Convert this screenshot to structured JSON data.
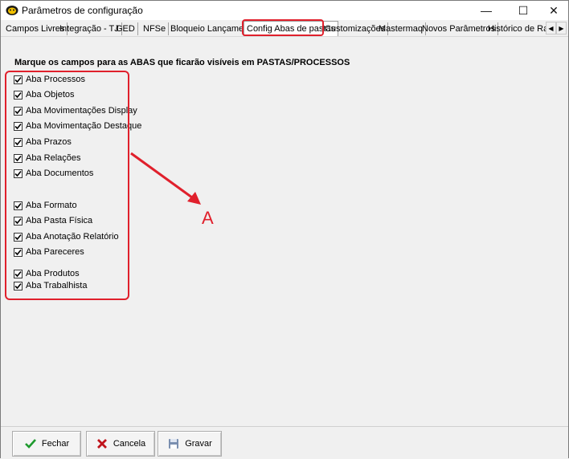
{
  "window": {
    "title": "Parâmetros de configuração",
    "minimize": "—",
    "maximize": "☐",
    "close": "✕"
  },
  "tabs": [
    {
      "label": "Campos Livres",
      "active": false
    },
    {
      "label": "Integração - TJ",
      "active": false
    },
    {
      "label": "GED",
      "active": false
    },
    {
      "label": "NFSe",
      "active": false
    },
    {
      "label": "Bloqueio Lançamento",
      "active": false
    },
    {
      "label": "Config Abas de pastas",
      "active": true
    },
    {
      "label": "Customizações",
      "active": false
    },
    {
      "label": "Mastermaq",
      "active": false
    },
    {
      "label": "Novos Parâmetros",
      "active": false
    },
    {
      "label": "Histórico de Rateio",
      "active": false
    }
  ],
  "tab_scroll": {
    "left": "◀",
    "right": "▶"
  },
  "instruction": "Marque os campos para as ABAS que ficarão visíveis em PASTAS/PROCESSOS",
  "checkboxes": [
    {
      "label": "Aba Processos",
      "checked": true
    },
    {
      "label": "Aba Objetos",
      "checked": true
    },
    {
      "label": "Aba Movimentações Display",
      "checked": true
    },
    {
      "label": "Aba Movimentação Destaque",
      "checked": true
    },
    {
      "label": "Aba Prazos",
      "checked": true
    },
    {
      "label": "Aba Relações",
      "checked": true
    },
    {
      "label": "Aba Documentos",
      "checked": true
    },
    {
      "label": "Aba Formato",
      "checked": true
    },
    {
      "label": "Aba Pasta Física",
      "checked": true
    },
    {
      "label": "Aba Anotação Relatório",
      "checked": true
    },
    {
      "label": "Aba Pareceres",
      "checked": true
    },
    {
      "label": "Aba Produtos",
      "checked": true
    },
    {
      "label": "Aba Trabalhista",
      "checked": true
    }
  ],
  "annotation": {
    "letter": "A",
    "color": "#e0202c"
  },
  "buttons": {
    "fechar": "Fechar",
    "cancela": "Cancela",
    "gravar": "Gravar"
  },
  "icons": {
    "app": "lion-logo-icon",
    "fechar": "green-check-icon",
    "cancela": "red-x-icon",
    "gravar": "save-disk-icon"
  }
}
